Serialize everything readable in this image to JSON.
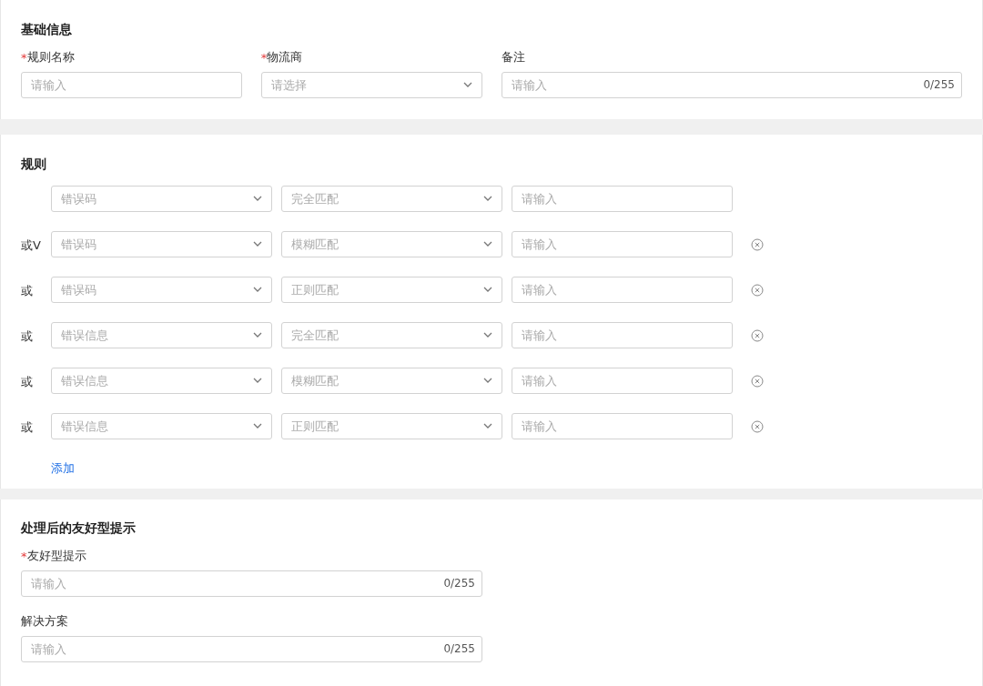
{
  "basic_info": {
    "title": "基础信息",
    "fields": [
      {
        "kind": "input",
        "label": "规则名称",
        "required_mark": "*",
        "placeholder": "请输入"
      },
      {
        "kind": "select",
        "label": "物流商",
        "required_mark": "*",
        "placeholder": "请选择"
      },
      {
        "kind": "counter",
        "label": "备注",
        "placeholder": "请输入",
        "counter": "0/255"
      }
    ]
  },
  "rules": {
    "title": "规则",
    "rows": [
      {
        "connector": "",
        "field_placeholder": "错误码",
        "match_placeholder": "完全匹配",
        "value_placeholder": "请输入",
        "removable": false
      },
      {
        "connector": "或V",
        "field_placeholder": "错误码",
        "match_placeholder": "模糊匹配",
        "value_placeholder": "请输入",
        "removable": true
      },
      {
        "connector": "或",
        "field_placeholder": "错误码",
        "match_placeholder": "正则匹配",
        "value_placeholder": "请输入",
        "removable": true
      },
      {
        "connector": "或",
        "field_placeholder": "错误信息",
        "match_placeholder": "完全匹配",
        "value_placeholder": "请输入",
        "removable": true
      },
      {
        "connector": "或",
        "field_placeholder": "错误信息",
        "match_placeholder": "模糊匹配",
        "value_placeholder": "请输入",
        "removable": true
      },
      {
        "connector": "或",
        "field_placeholder": "错误信息",
        "match_placeholder": "正则匹配",
        "value_placeholder": "请输入",
        "removable": true
      }
    ],
    "add_link": "添加"
  },
  "friendly_tip": {
    "title": "处理后的友好型提示",
    "fields": [
      {
        "label": "友好型提示",
        "required_mark": "*",
        "placeholder": "请输入",
        "counter": "0/255"
      },
      {
        "label": "解决方案",
        "placeholder": "请输入",
        "counter": "0/255"
      }
    ]
  }
}
